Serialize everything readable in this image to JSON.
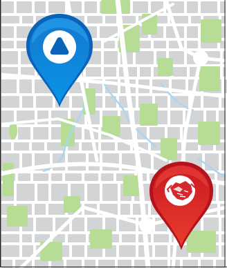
{
  "map": {
    "colors": {
      "block": "#d3d4d5",
      "road": "#ffffff",
      "park": "#b7dc96",
      "water": "#a9d7ee",
      "frame": "#202020"
    }
  },
  "pins": [
    {
      "id": "start",
      "icon": "triangle-icon",
      "colors": {
        "outer": "#0a63b8",
        "inner": "#0b8ee0",
        "highlight": "#2aa8f0",
        "dot": "#ffffff",
        "glyph": "#0a63b8"
      }
    },
    {
      "id": "destination",
      "icon": "handshake-icon",
      "colors": {
        "outer": "#b3131a",
        "inner": "#e2282d",
        "highlight": "#f0493f",
        "dot": "#ffffff",
        "glyph": "#d3282c"
      }
    }
  ]
}
